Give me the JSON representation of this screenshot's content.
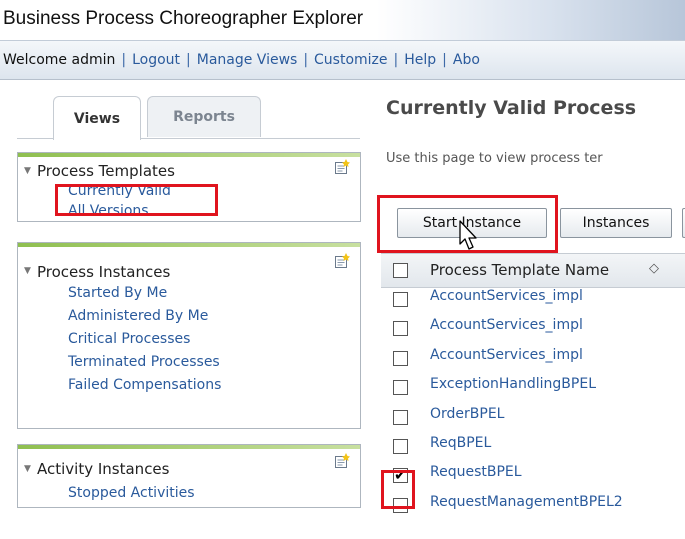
{
  "app": {
    "title": "Business Process Choreographer Explorer"
  },
  "nav": {
    "welcome": "Welcome admin",
    "links": [
      "Logout",
      "Manage Views",
      "Customize",
      "Help",
      "Abo"
    ]
  },
  "tabs": [
    {
      "label": "Views",
      "active": true
    },
    {
      "label": "Reports",
      "active": false
    }
  ],
  "sections": [
    {
      "title": "Process Templates",
      "items": [
        "Currently Valid",
        "All Versions"
      ]
    },
    {
      "title": "Process Instances",
      "items": [
        "Started By Me",
        "Administered By Me",
        "Critical Processes",
        "Terminated Processes",
        "Failed Compensations"
      ]
    },
    {
      "title": "Activity Instances",
      "items": [
        "Stopped Activities"
      ]
    }
  ],
  "main": {
    "title": "Currently Valid Process",
    "description": "Use this page to view process ter",
    "buttons": [
      "Start Instance",
      "Instances"
    ],
    "table": {
      "header": "Process Template Name",
      "sort_icon": "sort-arrows-icon",
      "rows": [
        {
          "name": "AccountServices_impl",
          "checked": false
        },
        {
          "name": "AccountServices_impl",
          "checked": false
        },
        {
          "name": "AccountServices_impl",
          "checked": false
        },
        {
          "name": "ExceptionHandlingBPEL",
          "checked": false
        },
        {
          "name": "OrderBPEL",
          "checked": false
        },
        {
          "name": "ReqBPEL",
          "checked": false
        },
        {
          "name": "RequestBPEL",
          "checked": true
        },
        {
          "name": "RequestManagementBPEL2",
          "checked": false
        }
      ]
    }
  },
  "colors": {
    "link": "#2a5a9c",
    "highlight": "#e0141e",
    "section_accent": "#8fbf50"
  }
}
